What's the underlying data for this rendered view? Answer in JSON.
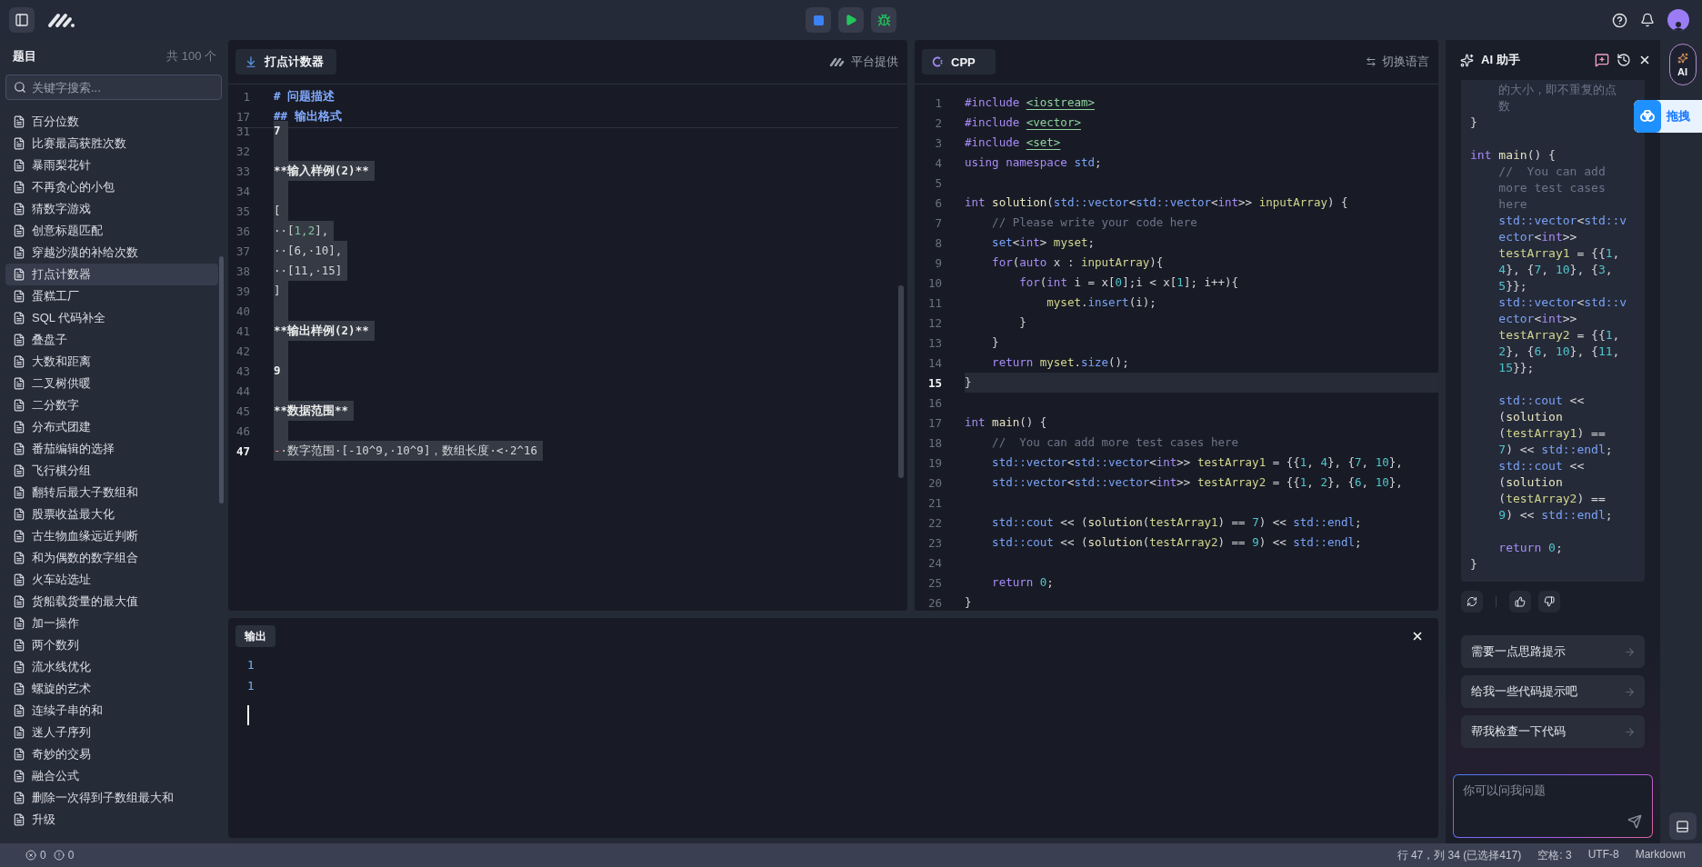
{
  "sidebar": {
    "title": "题目",
    "count": "共 100 个",
    "search": {
      "placeholder": "关键字搜索..."
    },
    "items": [
      {
        "label": "百分位数",
        "selected": false
      },
      {
        "label": "比赛最高获胜次数",
        "selected": false
      },
      {
        "label": "暴雨梨花针",
        "selected": false
      },
      {
        "label": "不再贪心的小包",
        "selected": false
      },
      {
        "label": "猜数字游戏",
        "selected": false
      },
      {
        "label": "创意标题匹配",
        "selected": false
      },
      {
        "label": "穿越沙漠的补给次数",
        "selected": false
      },
      {
        "label": "打点计数器",
        "selected": true
      },
      {
        "label": "蛋糕工厂",
        "selected": false
      },
      {
        "label": "SQL 代码补全",
        "selected": false
      },
      {
        "label": "叠盘子",
        "selected": false
      },
      {
        "label": "大数和距离",
        "selected": false
      },
      {
        "label": "二叉树供暖",
        "selected": false
      },
      {
        "label": "二分数字",
        "selected": false
      },
      {
        "label": "分布式团建",
        "selected": false
      },
      {
        "label": "番茄编辑的选择",
        "selected": false
      },
      {
        "label": "飞行棋分组",
        "selected": false
      },
      {
        "label": "翻转后最大子数组和",
        "selected": false
      },
      {
        "label": "股票收益最大化",
        "selected": false
      },
      {
        "label": "古生物血缘远近判断",
        "selected": false
      },
      {
        "label": "和为偶数的数字组合",
        "selected": false
      },
      {
        "label": "火车站选址",
        "selected": false
      },
      {
        "label": "货船载货量的最大值",
        "selected": false
      },
      {
        "label": "加一操作",
        "selected": false
      },
      {
        "label": "两个数列",
        "selected": false
      },
      {
        "label": "流水线优化",
        "selected": false
      },
      {
        "label": "螺旋的艺术",
        "selected": false
      },
      {
        "label": "连续子串的和",
        "selected": false
      },
      {
        "label": "迷人子序列",
        "selected": false
      },
      {
        "label": "奇妙的交易",
        "selected": false
      },
      {
        "label": "融合公式",
        "selected": false
      },
      {
        "label": "删除一次得到子数组最大和",
        "selected": false
      },
      {
        "label": "升级",
        "selected": false
      }
    ]
  },
  "problem_editor": {
    "tab": "打点计数器",
    "source": "平台提供",
    "sticky_lines": [
      {
        "number": "1",
        "tokens": [
          {
            "kind": "h",
            "text": "# 问题描述"
          }
        ]
      },
      {
        "number": "17",
        "tokens": [
          {
            "kind": "h",
            "text": "## 输出格式"
          }
        ]
      }
    ],
    "lines": [
      {
        "number": "31",
        "selected": true,
        "current": false,
        "tokens": [
          {
            "kind": "b",
            "text": "7"
          }
        ]
      },
      {
        "number": "32",
        "selected": true,
        "current": false
      },
      {
        "number": "33",
        "selected": true,
        "current": false,
        "tokens": [
          {
            "kind": "b",
            "text": "**输入样例(2)**"
          }
        ]
      },
      {
        "number": "34",
        "selected": true,
        "current": false
      },
      {
        "number": "35",
        "selected": true,
        "current": false,
        "tokens": [
          {
            "kind": "p",
            "text": "["
          }
        ]
      },
      {
        "number": "36",
        "selected": true,
        "current": false,
        "tokens": [
          {
            "kind": "p",
            "text": "··["
          },
          {
            "kind": "g",
            "text": "1,2"
          },
          {
            "kind": "p",
            "text": "],"
          }
        ]
      },
      {
        "number": "37",
        "selected": true,
        "current": false,
        "tokens": [
          {
            "kind": "p",
            "text": "··[6,·10],"
          }
        ]
      },
      {
        "number": "38",
        "selected": true,
        "current": false,
        "tokens": [
          {
            "kind": "p",
            "text": "··[11,·15]"
          }
        ]
      },
      {
        "number": "39",
        "selected": true,
        "current": false,
        "tokens": [
          {
            "kind": "p",
            "text": "]"
          }
        ]
      },
      {
        "number": "40",
        "selected": true,
        "current": false
      },
      {
        "number": "41",
        "selected": true,
        "current": false,
        "tokens": [
          {
            "kind": "b",
            "text": "**输出样例(2)**"
          }
        ]
      },
      {
        "number": "42",
        "selected": true,
        "current": false
      },
      {
        "number": "43",
        "selected": true,
        "current": false,
        "tokens": [
          {
            "kind": "b",
            "text": "9"
          }
        ]
      },
      {
        "number": "44",
        "selected": true,
        "current": false
      },
      {
        "number": "45",
        "selected": true,
        "current": false,
        "tokens": [
          {
            "kind": "b",
            "text": "**数据范围**"
          }
        ]
      },
      {
        "number": "46",
        "selected": true,
        "current": false
      },
      {
        "number": "47",
        "selected": true,
        "current": true,
        "tokens": [
          {
            "kind": "d",
            "text": "-"
          },
          {
            "kind": "p",
            "text": "·数字范围·[-10^9,·10^9]，数组长度·<·2^16"
          }
        ]
      }
    ]
  },
  "code_editor": {
    "language": "CPP",
    "switch": "切换语言",
    "lines": [
      {
        "number": "1",
        "current": false,
        "tokens": [
          {
            "kind": "kw",
            "text": "#include "
          },
          {
            "kind": "inc",
            "text": "<iostream>"
          }
        ]
      },
      {
        "number": "2",
        "current": false,
        "tokens": [
          {
            "kind": "kw",
            "text": "#include "
          },
          {
            "kind": "inc",
            "text": "<vector>"
          }
        ]
      },
      {
        "number": "3",
        "current": false,
        "tokens": [
          {
            "kind": "kw",
            "text": "#include "
          },
          {
            "kind": "inc",
            "text": "<set>"
          }
        ]
      },
      {
        "number": "4",
        "current": false,
        "tokens": [
          {
            "kind": "kw",
            "text": "using namespace "
          },
          {
            "kind": "type",
            "text": "std"
          },
          {
            "kind": "p",
            "text": ";"
          }
        ]
      },
      {
        "number": "5",
        "current": false
      },
      {
        "number": "6",
        "current": false,
        "tokens": [
          {
            "kind": "kw",
            "text": "int "
          },
          {
            "kind": "fn",
            "text": "solution"
          },
          {
            "kind": "p",
            "text": "("
          },
          {
            "kind": "type",
            "text": "std::vector"
          },
          {
            "kind": "p",
            "text": "<"
          },
          {
            "kind": "type",
            "text": "std::vector"
          },
          {
            "kind": "p",
            "text": "<"
          },
          {
            "kind": "kw",
            "text": "int"
          },
          {
            "kind": "p",
            "text": ">> "
          },
          {
            "kind": "id",
            "text": "inputArray"
          },
          {
            "kind": "p",
            "text": ") {"
          }
        ]
      },
      {
        "number": "7",
        "current": false,
        "tokens": [
          {
            "kind": "cm",
            "text": "    // Please write your code here"
          }
        ]
      },
      {
        "number": "8",
        "current": false,
        "tokens": [
          {
            "kind": "type",
            "text": "    set"
          },
          {
            "kind": "p",
            "text": "<"
          },
          {
            "kind": "kw",
            "text": "int"
          },
          {
            "kind": "p",
            "text": "> "
          },
          {
            "kind": "id",
            "text": "myset"
          },
          {
            "kind": "p",
            "text": ";"
          }
        ]
      },
      {
        "number": "9",
        "current": false,
        "tokens": [
          {
            "kind": "kw",
            "text": "    for"
          },
          {
            "kind": "p",
            "text": "("
          },
          {
            "kind": "kw",
            "text": "auto"
          },
          {
            "kind": "p",
            "text": " x : "
          },
          {
            "kind": "id",
            "text": "inputArray"
          },
          {
            "kind": "p",
            "text": "){"
          }
        ]
      },
      {
        "number": "10",
        "current": false,
        "tokens": [
          {
            "kind": "kw",
            "text": "        for"
          },
          {
            "kind": "p",
            "text": "("
          },
          {
            "kind": "kw",
            "text": "int"
          },
          {
            "kind": "p",
            "text": " i = x["
          },
          {
            "kind": "num",
            "text": "0"
          },
          {
            "kind": "p",
            "text": "];i < x["
          },
          {
            "kind": "num",
            "text": "1"
          },
          {
            "kind": "p",
            "text": "]; i++){"
          }
        ]
      },
      {
        "number": "11",
        "current": false,
        "tokens": [
          {
            "kind": "id",
            "text": "            myset"
          },
          {
            "kind": "p",
            "text": "."
          },
          {
            "kind": "type",
            "text": "insert"
          },
          {
            "kind": "p",
            "text": "(i);"
          }
        ]
      },
      {
        "number": "12",
        "current": false,
        "tokens": [
          {
            "kind": "p",
            "text": "        }"
          }
        ]
      },
      {
        "number": "13",
        "current": false,
        "tokens": [
          {
            "kind": "p",
            "text": "    }"
          }
        ]
      },
      {
        "number": "14",
        "current": false,
        "tokens": [
          {
            "kind": "kw",
            "text": "    return "
          },
          {
            "kind": "id",
            "text": "myset"
          },
          {
            "kind": "p",
            "text": "."
          },
          {
            "kind": "type",
            "text": "size"
          },
          {
            "kind": "p",
            "text": "();"
          }
        ]
      },
      {
        "number": "15",
        "current": true,
        "tokens": [
          {
            "kind": "p",
            "text": "}"
          }
        ]
      },
      {
        "number": "16",
        "current": false
      },
      {
        "number": "17",
        "current": false,
        "tokens": [
          {
            "kind": "kw",
            "text": "int "
          },
          {
            "kind": "fn",
            "text": "main"
          },
          {
            "kind": "p",
            "text": "() {"
          }
        ]
      },
      {
        "number": "18",
        "current": false,
        "tokens": [
          {
            "kind": "cm",
            "text": "    //  You can add more test cases here"
          }
        ]
      },
      {
        "number": "19",
        "current": false,
        "tokens": [
          {
            "kind": "type",
            "text": "    std::vector"
          },
          {
            "kind": "p",
            "text": "<"
          },
          {
            "kind": "type",
            "text": "std::vector"
          },
          {
            "kind": "p",
            "text": "<"
          },
          {
            "kind": "kw",
            "text": "int"
          },
          {
            "kind": "p",
            "text": ">> "
          },
          {
            "kind": "id",
            "text": "testArray1"
          },
          {
            "kind": "p",
            "text": " = {{"
          },
          {
            "kind": "num",
            "text": "1"
          },
          {
            "kind": "p",
            "text": ", "
          },
          {
            "kind": "num",
            "text": "4"
          },
          {
            "kind": "p",
            "text": "}, {"
          },
          {
            "kind": "num",
            "text": "7"
          },
          {
            "kind": "p",
            "text": ", "
          },
          {
            "kind": "num",
            "text": "10"
          },
          {
            "kind": "p",
            "text": "},"
          }
        ]
      },
      {
        "number": "20",
        "current": false,
        "tokens": [
          {
            "kind": "type",
            "text": "    std::vector"
          },
          {
            "kind": "p",
            "text": "<"
          },
          {
            "kind": "type",
            "text": "std::vector"
          },
          {
            "kind": "p",
            "text": "<"
          },
          {
            "kind": "kw",
            "text": "int"
          },
          {
            "kind": "p",
            "text": ">> "
          },
          {
            "kind": "id",
            "text": "testArray2"
          },
          {
            "kind": "p",
            "text": " = {{"
          },
          {
            "kind": "num",
            "text": "1"
          },
          {
            "kind": "p",
            "text": ", "
          },
          {
            "kind": "num",
            "text": "2"
          },
          {
            "kind": "p",
            "text": "}, {"
          },
          {
            "kind": "num",
            "text": "6"
          },
          {
            "kind": "p",
            "text": ", "
          },
          {
            "kind": "num",
            "text": "10"
          },
          {
            "kind": "p",
            "text": "},"
          }
        ]
      },
      {
        "number": "21",
        "current": false
      },
      {
        "number": "22",
        "current": false,
        "tokens": [
          {
            "kind": "type",
            "text": "    std::cout"
          },
          {
            "kind": "p",
            "text": " << ("
          },
          {
            "kind": "fn",
            "text": "solution"
          },
          {
            "kind": "p",
            "text": "("
          },
          {
            "kind": "id",
            "text": "testArray1"
          },
          {
            "kind": "p",
            "text": ") == "
          },
          {
            "kind": "num",
            "text": "7"
          },
          {
            "kind": "p",
            "text": ") << "
          },
          {
            "kind": "type",
            "text": "std::endl"
          },
          {
            "kind": "p",
            "text": ";"
          }
        ]
      },
      {
        "number": "23",
        "current": false,
        "tokens": [
          {
            "kind": "type",
            "text": "    std::cout"
          },
          {
            "kind": "p",
            "text": " << ("
          },
          {
            "kind": "fn",
            "text": "solution"
          },
          {
            "kind": "p",
            "text": "("
          },
          {
            "kind": "id",
            "text": "testArray2"
          },
          {
            "kind": "p",
            "text": ") == "
          },
          {
            "kind": "num",
            "text": "9"
          },
          {
            "kind": "p",
            "text": ") << "
          },
          {
            "kind": "type",
            "text": "std::endl"
          },
          {
            "kind": "p",
            "text": ";"
          }
        ]
      },
      {
        "number": "24",
        "current": false
      },
      {
        "number": "25",
        "current": false,
        "tokens": [
          {
            "kind": "kw",
            "text": "    return "
          },
          {
            "kind": "num",
            "text": "0"
          },
          {
            "kind": "p",
            "text": ";"
          }
        ]
      },
      {
        "number": "26",
        "current": false,
        "tokens": [
          {
            "kind": "p",
            "text": "}"
          }
        ]
      }
    ]
  },
  "output": {
    "tab": "输出",
    "lines": [
      "1",
      "1"
    ]
  },
  "assistant": {
    "title": "AI 助手",
    "message_lines": [
      {
        "tokens": [
          {
            "kind": "cm",
            "text": "    的大小，即不重复的点"
          }
        ]
      },
      {
        "tokens": [
          {
            "kind": "cm",
            "text": "    数"
          }
        ]
      },
      {
        "tokens": [
          {
            "kind": "p",
            "text": "}"
          }
        ]
      },
      {
        "kind": "blank"
      },
      {
        "tokens": [
          {
            "kind": "kw",
            "text": "int "
          },
          {
            "kind": "fn",
            "text": "main"
          },
          {
            "kind": "p",
            "text": "() {"
          }
        ]
      },
      {
        "tokens": [
          {
            "kind": "cm",
            "text": "    //  You can add"
          }
        ]
      },
      {
        "tokens": [
          {
            "kind": "cm",
            "text": "    more test cases"
          }
        ]
      },
      {
        "tokens": [
          {
            "kind": "cm",
            "text": "    here"
          }
        ]
      },
      {
        "tokens": [
          {
            "kind": "type",
            "text": "    std::vector"
          },
          {
            "kind": "p",
            "text": "<"
          },
          {
            "kind": "type",
            "text": "std::v"
          }
        ]
      },
      {
        "tokens": [
          {
            "kind": "type",
            "text": "    ector"
          },
          {
            "kind": "p",
            "text": "<"
          },
          {
            "kind": "kw",
            "text": "int"
          },
          {
            "kind": "p",
            "text": ">>"
          }
        ]
      },
      {
        "tokens": [
          {
            "kind": "id",
            "text": "    testArray1"
          },
          {
            "kind": "p",
            "text": " = {{"
          },
          {
            "kind": "num",
            "text": "1"
          },
          {
            "kind": "p",
            "text": ","
          }
        ]
      },
      {
        "tokens": [
          {
            "kind": "num",
            "text": "    4"
          },
          {
            "kind": "p",
            "text": "}, {"
          },
          {
            "kind": "num",
            "text": "7"
          },
          {
            "kind": "p",
            "text": ", "
          },
          {
            "kind": "num",
            "text": "10"
          },
          {
            "kind": "p",
            "text": "}, {"
          },
          {
            "kind": "num",
            "text": "3"
          },
          {
            "kind": "p",
            "text": ","
          }
        ]
      },
      {
        "tokens": [
          {
            "kind": "num",
            "text": "    5"
          },
          {
            "kind": "p",
            "text": "}};"
          }
        ]
      },
      {
        "tokens": [
          {
            "kind": "type",
            "text": "    std::vector"
          },
          {
            "kind": "p",
            "text": "<"
          },
          {
            "kind": "type",
            "text": "std::v"
          }
        ]
      },
      {
        "tokens": [
          {
            "kind": "type",
            "text": "    ector"
          },
          {
            "kind": "p",
            "text": "<"
          },
          {
            "kind": "kw",
            "text": "int"
          },
          {
            "kind": "p",
            "text": ">>"
          }
        ]
      },
      {
        "tokens": [
          {
            "kind": "id",
            "text": "    testArray2"
          },
          {
            "kind": "p",
            "text": " = {{"
          },
          {
            "kind": "num",
            "text": "1"
          },
          {
            "kind": "p",
            "text": ","
          }
        ]
      },
      {
        "tokens": [
          {
            "kind": "num",
            "text": "    2"
          },
          {
            "kind": "p",
            "text": "}, {"
          },
          {
            "kind": "num",
            "text": "6"
          },
          {
            "kind": "p",
            "text": ", "
          },
          {
            "kind": "num",
            "text": "10"
          },
          {
            "kind": "p",
            "text": "}, {"
          },
          {
            "kind": "num",
            "text": "11"
          },
          {
            "kind": "p",
            "text": ","
          }
        ]
      },
      {
        "tokens": [
          {
            "kind": "num",
            "text": "    15"
          },
          {
            "kind": "p",
            "text": "}};"
          }
        ]
      },
      {
        "kind": "blank"
      },
      {
        "tokens": [
          {
            "kind": "type",
            "text": "    std::cout"
          },
          {
            "kind": "p",
            "text": " <<"
          }
        ]
      },
      {
        "tokens": [
          {
            "kind": "p",
            "text": "    ("
          },
          {
            "kind": "fn",
            "text": "solution"
          }
        ]
      },
      {
        "tokens": [
          {
            "kind": "p",
            "text": "    ("
          },
          {
            "kind": "id",
            "text": "testArray1"
          },
          {
            "kind": "p",
            "text": ") =="
          }
        ]
      },
      {
        "tokens": [
          {
            "kind": "num",
            "text": "    7"
          },
          {
            "kind": "p",
            "text": ") << "
          },
          {
            "kind": "type",
            "text": "std::endl"
          },
          {
            "kind": "p",
            "text": ";"
          }
        ]
      },
      {
        "tokens": [
          {
            "kind": "type",
            "text": "    std::cout"
          },
          {
            "kind": "p",
            "text": " <<"
          }
        ]
      },
      {
        "tokens": [
          {
            "kind": "p",
            "text": "    ("
          },
          {
            "kind": "fn",
            "text": "solution"
          }
        ]
      },
      {
        "tokens": [
          {
            "kind": "p",
            "text": "    ("
          },
          {
            "kind": "id",
            "text": "testArray2"
          },
          {
            "kind": "p",
            "text": ") =="
          }
        ]
      },
      {
        "tokens": [
          {
            "kind": "num",
            "text": "    9"
          },
          {
            "kind": "p",
            "text": ") << "
          },
          {
            "kind": "type",
            "text": "std::endl"
          },
          {
            "kind": "p",
            "text": ";"
          }
        ]
      },
      {
        "kind": "blank"
      },
      {
        "tokens": [
          {
            "kind": "kw",
            "text": "    return "
          },
          {
            "kind": "num",
            "text": "0"
          },
          {
            "kind": "p",
            "text": ";"
          }
        ]
      },
      {
        "tokens": [
          {
            "kind": "p",
            "text": "}"
          }
        ]
      }
    ],
    "suggestions": [
      "需要一点思路提示",
      "给我一些代码提示吧",
      "帮我检查一下代码"
    ],
    "input": {
      "placeholder": "你可以问我问题"
    }
  },
  "rail": {
    "ai_button": "AI",
    "drag_badge": "拖拽"
  },
  "status_bar": {
    "errors": "0",
    "warnings": "0",
    "position": "行 47，列 34 (已选择417)",
    "indent": "空格: 3",
    "encoding": "UTF-8",
    "language_mode": "Markdown"
  }
}
